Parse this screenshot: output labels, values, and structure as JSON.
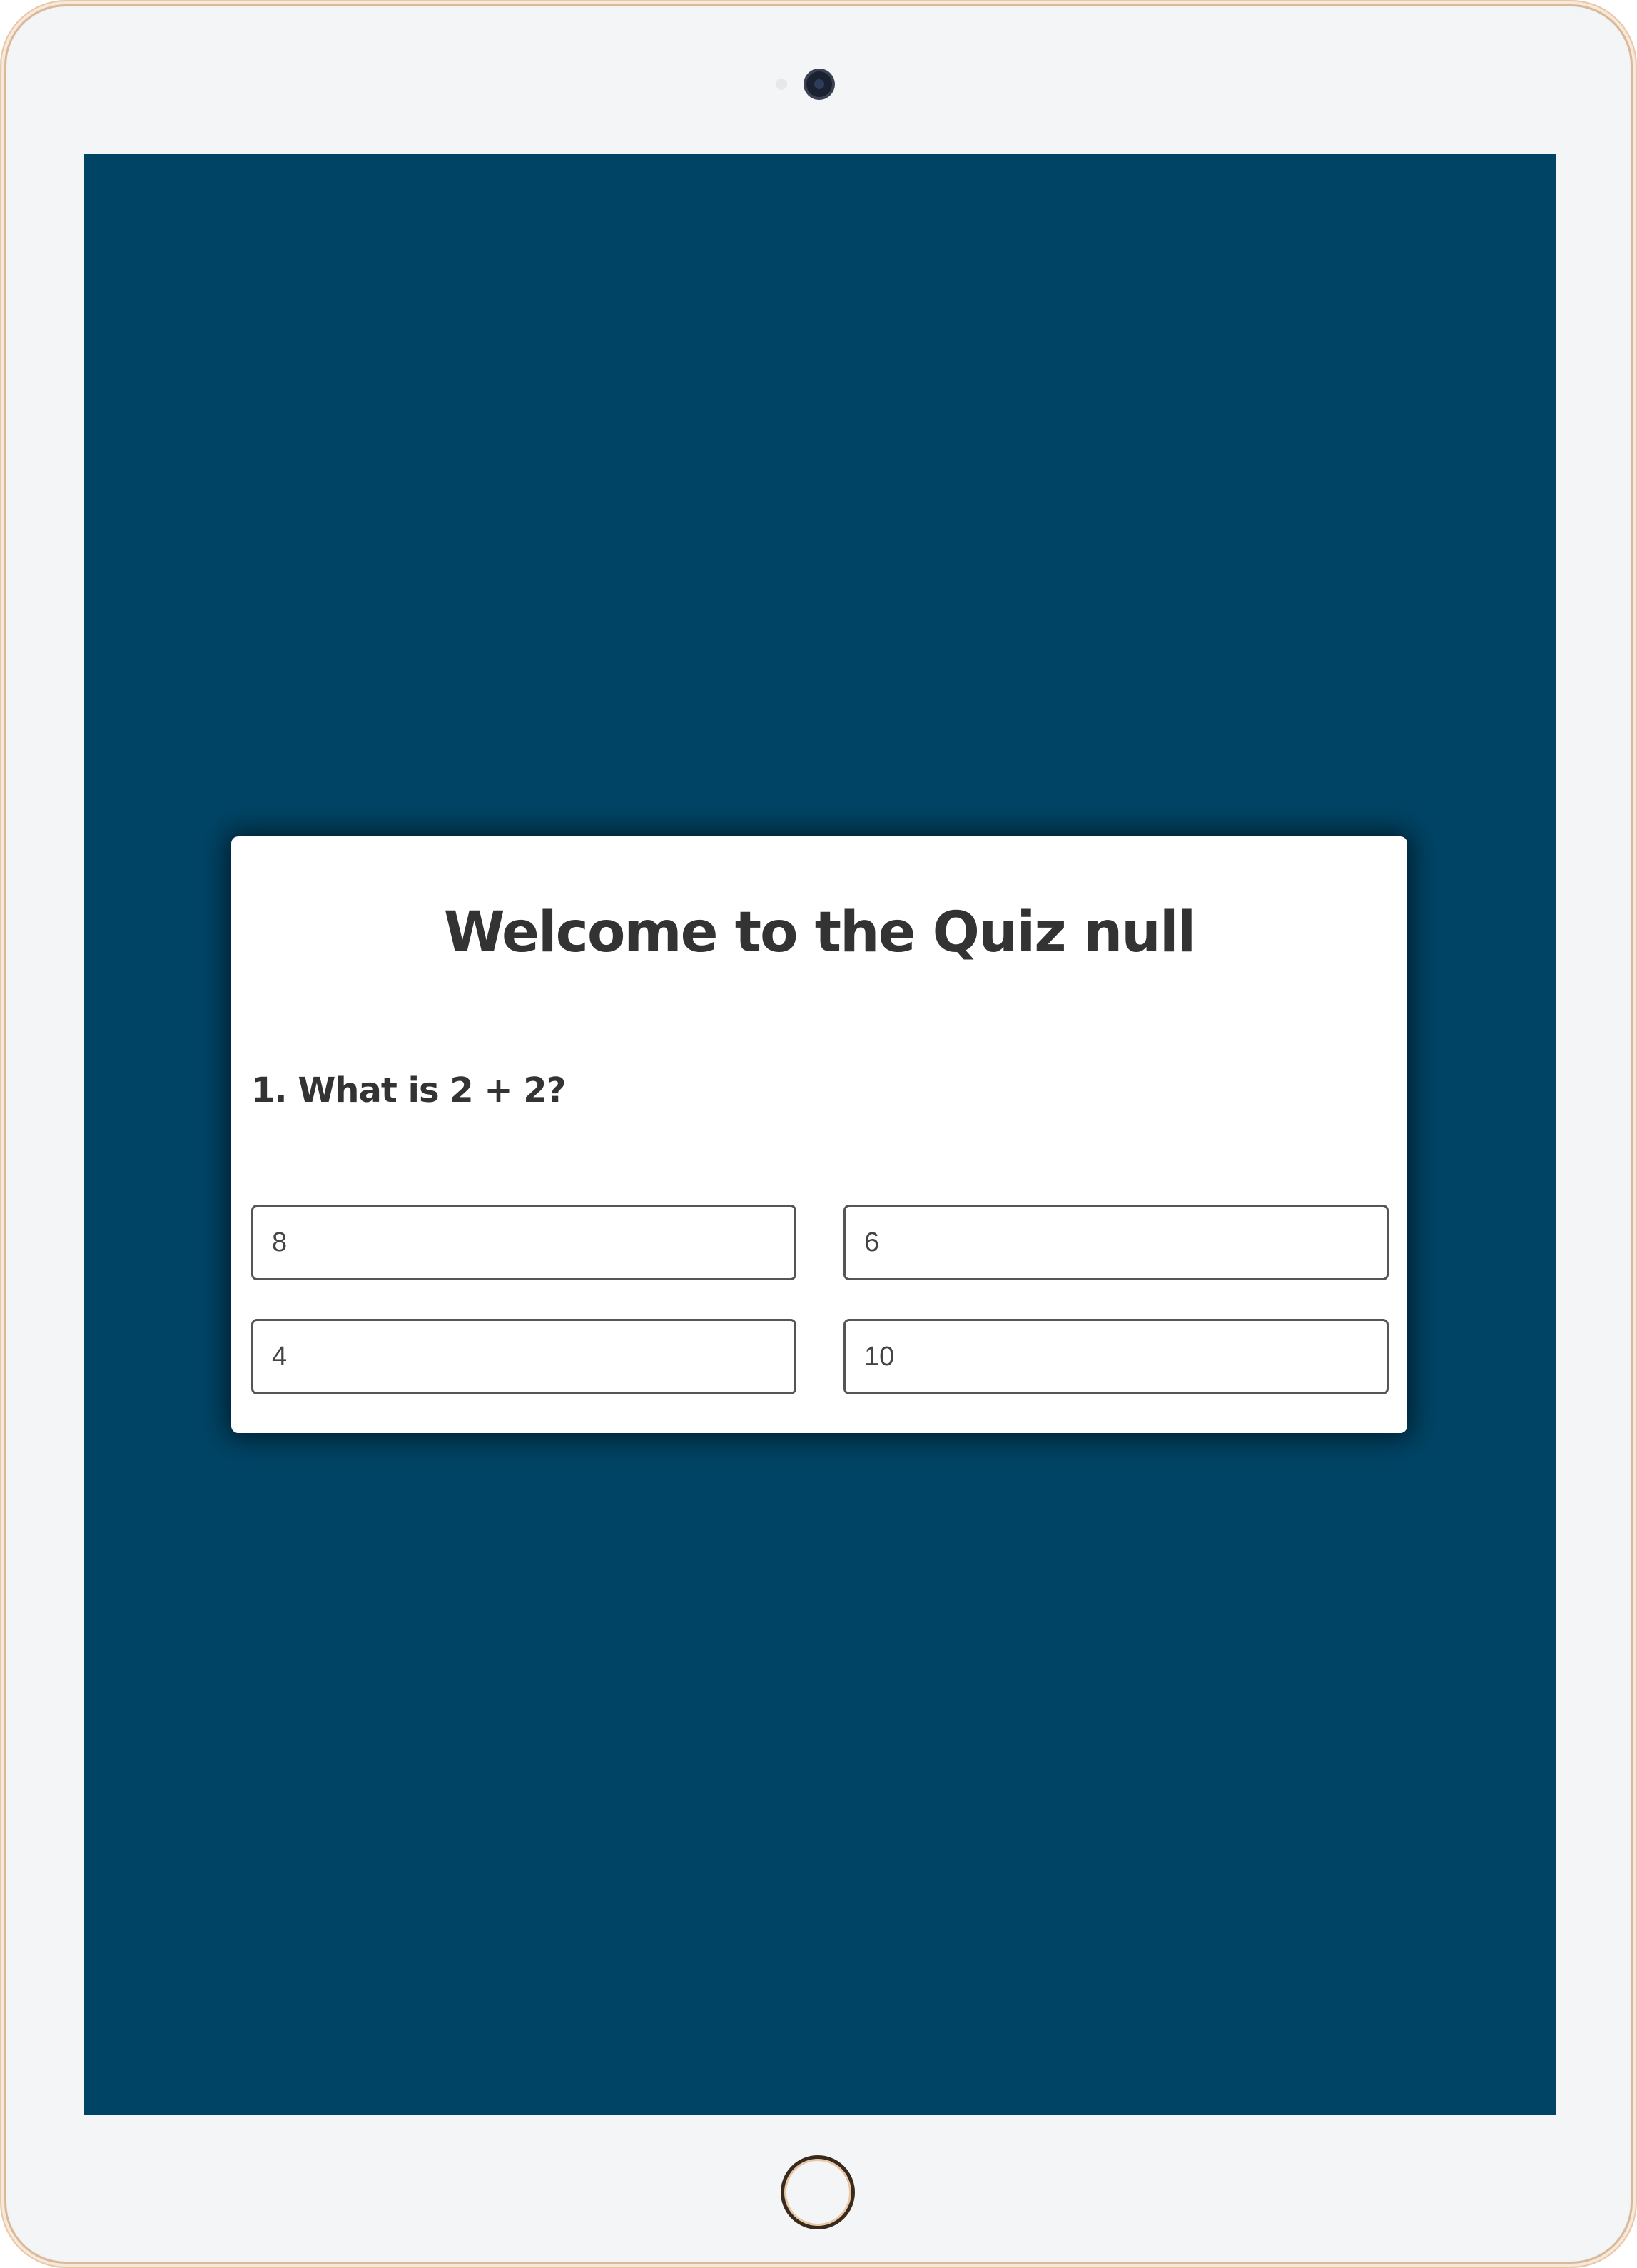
{
  "quiz": {
    "title": "Welcome to the Quiz null",
    "question": "1. What is 2 + 2?",
    "answers": [
      "8",
      "6",
      "4",
      "10"
    ]
  },
  "colors": {
    "screen_background": "#004465",
    "card_background": "#ffffff",
    "text": "#333333"
  },
  "icons": {
    "camera": "camera-icon",
    "sensor": "sensor-icon",
    "home": "home-button-icon"
  }
}
